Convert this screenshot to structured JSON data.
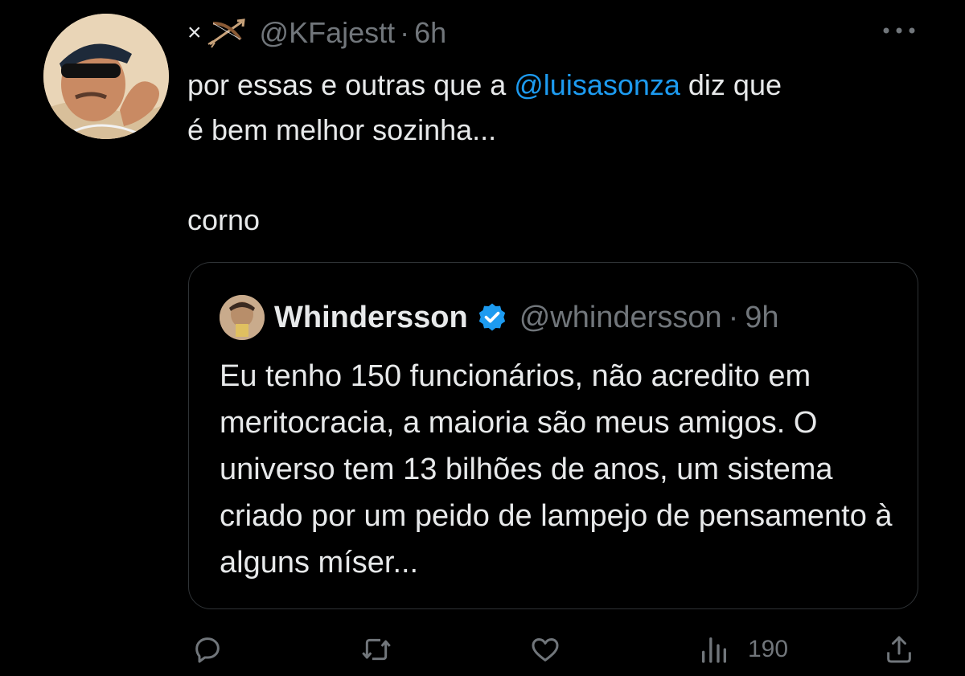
{
  "tweet": {
    "prefix_symbol": "×",
    "handle": "@KFajestt",
    "separator": "·",
    "time": "6h",
    "text_before_mention": "por essas e outras que a ",
    "mention": "@luisasonza",
    "text_after_mention": " diz que\né bem melhor sozinha...\n\ncorno"
  },
  "quote": {
    "name": "Whindersson",
    "handle": "@whindersson",
    "separator": "·",
    "time": "9h",
    "text": "Eu tenho 150 funcionários, não acredito em meritocracia, a maioria são meus amigos. O universo tem 13 bilhões de anos, um sistema criado por um peido de lampejo de pensamento à alguns míser..."
  },
  "actions": {
    "views_count": "190"
  },
  "icons": {
    "more": "more-horizontal-icon",
    "reply": "reply-icon",
    "retweet": "retweet-icon",
    "like": "heart-icon",
    "views": "views-icon",
    "share": "share-icon",
    "verified": "verified-badge-icon",
    "bow": "bow-and-arrow-icon"
  },
  "colors": {
    "background": "#000000",
    "text": "#e7e9ea",
    "secondary": "#71767b",
    "accent": "#1d9bf0",
    "border": "#2f3336"
  }
}
